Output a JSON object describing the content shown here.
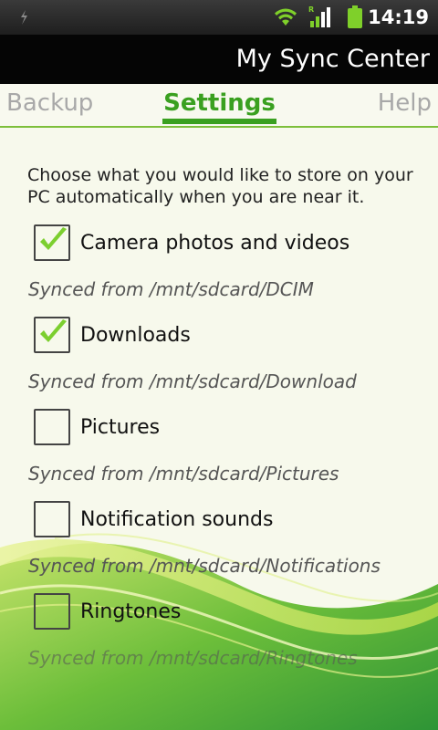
{
  "status_bar": {
    "time": "14:19",
    "icons": [
      "usb-debug-icon",
      "wifi-icon",
      "signal-icon",
      "battery-icon"
    ]
  },
  "app": {
    "title": "My Sync Center"
  },
  "tabs": [
    {
      "label": "Backup",
      "selected": false
    },
    {
      "label": "Settings",
      "selected": true
    },
    {
      "label": "Help",
      "selected": false
    }
  ],
  "settings": {
    "intro": "Choose what you would like to store on your PC automatically when you are near it.",
    "items": [
      {
        "label": "Camera photos and videos",
        "checked": true,
        "path": "Synced from /mnt/sdcard/DCIM"
      },
      {
        "label": "Downloads",
        "checked": true,
        "path": "Synced from /mnt/sdcard/Download"
      },
      {
        "label": "Pictures",
        "checked": false,
        "path": "Synced from /mnt/sdcard/Pictures"
      },
      {
        "label": "Notification sounds",
        "checked": false,
        "path": "Synced from /mnt/sdcard/Notifications"
      },
      {
        "label": "Ringtones",
        "checked": false,
        "path": "Synced from /mnt/sdcard/Ringtones"
      }
    ]
  },
  "colors": {
    "accent": "#3aa020",
    "check": "#7ccf2f",
    "background": "#f7f9ec"
  }
}
